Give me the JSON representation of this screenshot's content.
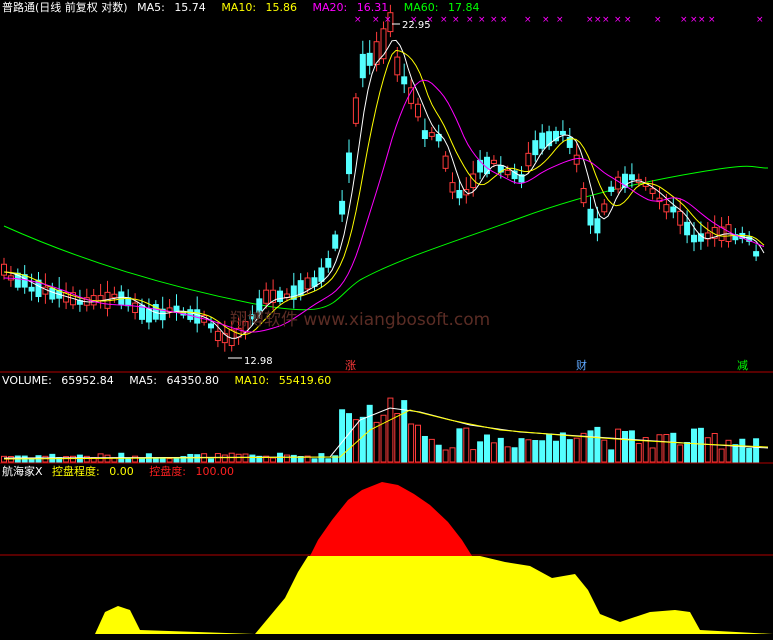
{
  "app": {
    "title": "普路通(日线 前复权 对数)"
  },
  "main_panel": {
    "indicators": [
      {
        "label": "MA5:",
        "value": "15.74",
        "color": "#ffffff"
      },
      {
        "label": "MA10:",
        "value": "15.86",
        "color": "#ffff00"
      },
      {
        "label": "MA20:",
        "value": "16.31",
        "color": "#ff00ff"
      },
      {
        "label": "MA60:",
        "value": "17.84",
        "color": "#00ff00"
      }
    ],
    "high_label": "22.95",
    "low_label": "12.98",
    "watermark": "翔博软件 www.xiangbosoft.com",
    "events": [
      {
        "text": "涨",
        "color": "#ff3b3b"
      },
      {
        "text": "财",
        "color": "#5fa8ff"
      },
      {
        "text": "减",
        "color": "#00ff00"
      }
    ]
  },
  "volume_panel": {
    "indicators": [
      {
        "label": "VOLUME:",
        "value": "65952.84",
        "color": "#ffffff"
      },
      {
        "label": "MA5:",
        "value": "64350.80",
        "color": "#ffffff"
      },
      {
        "label": "MA10:",
        "value": "55419.60",
        "color": "#ffff00"
      }
    ]
  },
  "indicator_panel": {
    "name": "航海家X",
    "indicators": [
      {
        "label": "控盘程度:",
        "value": "0.00",
        "color": "#ffff00"
      },
      {
        "label": "控盘度:",
        "value": "100.00",
        "color": "#ff2020"
      }
    ]
  },
  "colors": {
    "up": "#ff3b3b",
    "down": "#54ffff",
    "ma5": "#ffffff",
    "ma10": "#ffff00",
    "ma20": "#ff00ff",
    "ma60": "#00ff00",
    "divider": "#b00000",
    "control": "#ff0000",
    "degree": "#ffff00"
  }
}
